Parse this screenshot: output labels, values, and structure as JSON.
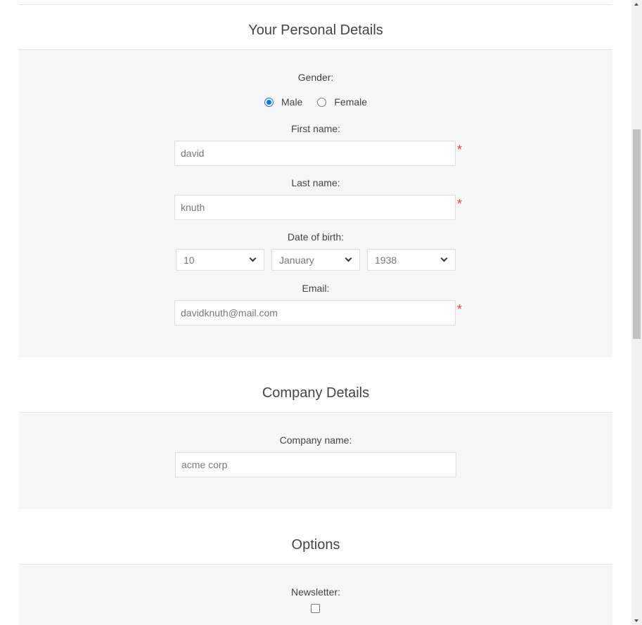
{
  "personal": {
    "title": "Your Personal Details",
    "gender_label": "Gender:",
    "gender_options": [
      "Male",
      "Female"
    ],
    "gender_selected": "Male",
    "first_name_label": "First name:",
    "first_name_value": "david",
    "last_name_label": "Last name:",
    "last_name_value": "knuth",
    "dob_label": "Date of birth:",
    "dob_day": "10",
    "dob_month": "January",
    "dob_year": "1938",
    "email_label": "Email:",
    "email_value": "davidknuth@mail.com",
    "required_marker": "*"
  },
  "company": {
    "title": "Company Details",
    "company_name_label": "Company name:",
    "company_name_value": "acme corp"
  },
  "options": {
    "title": "Options",
    "newsletter_label": "Newsletter:",
    "newsletter_checked": false
  },
  "colors": {
    "accent": "#0075ff",
    "required": "#e4434b",
    "panel_bg": "#f6f6f6"
  }
}
